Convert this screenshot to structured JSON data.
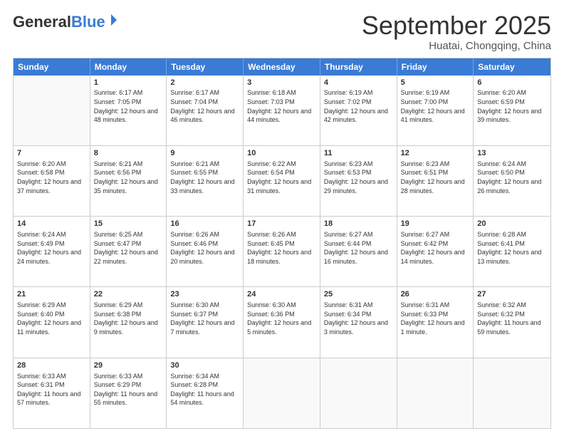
{
  "header": {
    "logo": {
      "general": "General",
      "blue": "Blue"
    },
    "title": "September 2025",
    "location": "Huatai, Chongqing, China"
  },
  "calendar": {
    "days_of_week": [
      "Sunday",
      "Monday",
      "Tuesday",
      "Wednesday",
      "Thursday",
      "Friday",
      "Saturday"
    ],
    "weeks": [
      [
        {
          "day": "",
          "sunrise": "",
          "sunset": "",
          "daylight": ""
        },
        {
          "day": "1",
          "sunrise": "Sunrise: 6:17 AM",
          "sunset": "Sunset: 7:05 PM",
          "daylight": "Daylight: 12 hours and 48 minutes."
        },
        {
          "day": "2",
          "sunrise": "Sunrise: 6:17 AM",
          "sunset": "Sunset: 7:04 PM",
          "daylight": "Daylight: 12 hours and 46 minutes."
        },
        {
          "day": "3",
          "sunrise": "Sunrise: 6:18 AM",
          "sunset": "Sunset: 7:03 PM",
          "daylight": "Daylight: 12 hours and 44 minutes."
        },
        {
          "day": "4",
          "sunrise": "Sunrise: 6:19 AM",
          "sunset": "Sunset: 7:02 PM",
          "daylight": "Daylight: 12 hours and 42 minutes."
        },
        {
          "day": "5",
          "sunrise": "Sunrise: 6:19 AM",
          "sunset": "Sunset: 7:00 PM",
          "daylight": "Daylight: 12 hours and 41 minutes."
        },
        {
          "day": "6",
          "sunrise": "Sunrise: 6:20 AM",
          "sunset": "Sunset: 6:59 PM",
          "daylight": "Daylight: 12 hours and 39 minutes."
        }
      ],
      [
        {
          "day": "7",
          "sunrise": "Sunrise: 6:20 AM",
          "sunset": "Sunset: 6:58 PM",
          "daylight": "Daylight: 12 hours and 37 minutes."
        },
        {
          "day": "8",
          "sunrise": "Sunrise: 6:21 AM",
          "sunset": "Sunset: 6:56 PM",
          "daylight": "Daylight: 12 hours and 35 minutes."
        },
        {
          "day": "9",
          "sunrise": "Sunrise: 6:21 AM",
          "sunset": "Sunset: 6:55 PM",
          "daylight": "Daylight: 12 hours and 33 minutes."
        },
        {
          "day": "10",
          "sunrise": "Sunrise: 6:22 AM",
          "sunset": "Sunset: 6:54 PM",
          "daylight": "Daylight: 12 hours and 31 minutes."
        },
        {
          "day": "11",
          "sunrise": "Sunrise: 6:23 AM",
          "sunset": "Sunset: 6:53 PM",
          "daylight": "Daylight: 12 hours and 29 minutes."
        },
        {
          "day": "12",
          "sunrise": "Sunrise: 6:23 AM",
          "sunset": "Sunset: 6:51 PM",
          "daylight": "Daylight: 12 hours and 28 minutes."
        },
        {
          "day": "13",
          "sunrise": "Sunrise: 6:24 AM",
          "sunset": "Sunset: 6:50 PM",
          "daylight": "Daylight: 12 hours and 26 minutes."
        }
      ],
      [
        {
          "day": "14",
          "sunrise": "Sunrise: 6:24 AM",
          "sunset": "Sunset: 6:49 PM",
          "daylight": "Daylight: 12 hours and 24 minutes."
        },
        {
          "day": "15",
          "sunrise": "Sunrise: 6:25 AM",
          "sunset": "Sunset: 6:47 PM",
          "daylight": "Daylight: 12 hours and 22 minutes."
        },
        {
          "day": "16",
          "sunrise": "Sunrise: 6:26 AM",
          "sunset": "Sunset: 6:46 PM",
          "daylight": "Daylight: 12 hours and 20 minutes."
        },
        {
          "day": "17",
          "sunrise": "Sunrise: 6:26 AM",
          "sunset": "Sunset: 6:45 PM",
          "daylight": "Daylight: 12 hours and 18 minutes."
        },
        {
          "day": "18",
          "sunrise": "Sunrise: 6:27 AM",
          "sunset": "Sunset: 6:44 PM",
          "daylight": "Daylight: 12 hours and 16 minutes."
        },
        {
          "day": "19",
          "sunrise": "Sunrise: 6:27 AM",
          "sunset": "Sunset: 6:42 PM",
          "daylight": "Daylight: 12 hours and 14 minutes."
        },
        {
          "day": "20",
          "sunrise": "Sunrise: 6:28 AM",
          "sunset": "Sunset: 6:41 PM",
          "daylight": "Daylight: 12 hours and 13 minutes."
        }
      ],
      [
        {
          "day": "21",
          "sunrise": "Sunrise: 6:29 AM",
          "sunset": "Sunset: 6:40 PM",
          "daylight": "Daylight: 12 hours and 11 minutes."
        },
        {
          "day": "22",
          "sunrise": "Sunrise: 6:29 AM",
          "sunset": "Sunset: 6:38 PM",
          "daylight": "Daylight: 12 hours and 9 minutes."
        },
        {
          "day": "23",
          "sunrise": "Sunrise: 6:30 AM",
          "sunset": "Sunset: 6:37 PM",
          "daylight": "Daylight: 12 hours and 7 minutes."
        },
        {
          "day": "24",
          "sunrise": "Sunrise: 6:30 AM",
          "sunset": "Sunset: 6:36 PM",
          "daylight": "Daylight: 12 hours and 5 minutes."
        },
        {
          "day": "25",
          "sunrise": "Sunrise: 6:31 AM",
          "sunset": "Sunset: 6:34 PM",
          "daylight": "Daylight: 12 hours and 3 minutes."
        },
        {
          "day": "26",
          "sunrise": "Sunrise: 6:31 AM",
          "sunset": "Sunset: 6:33 PM",
          "daylight": "Daylight: 12 hours and 1 minute."
        },
        {
          "day": "27",
          "sunrise": "Sunrise: 6:32 AM",
          "sunset": "Sunset: 6:32 PM",
          "daylight": "Daylight: 11 hours and 59 minutes."
        }
      ],
      [
        {
          "day": "28",
          "sunrise": "Sunrise: 6:33 AM",
          "sunset": "Sunset: 6:31 PM",
          "daylight": "Daylight: 11 hours and 57 minutes."
        },
        {
          "day": "29",
          "sunrise": "Sunrise: 6:33 AM",
          "sunset": "Sunset: 6:29 PM",
          "daylight": "Daylight: 11 hours and 55 minutes."
        },
        {
          "day": "30",
          "sunrise": "Sunrise: 6:34 AM",
          "sunset": "Sunset: 6:28 PM",
          "daylight": "Daylight: 11 hours and 54 minutes."
        },
        {
          "day": "",
          "sunrise": "",
          "sunset": "",
          "daylight": ""
        },
        {
          "day": "",
          "sunrise": "",
          "sunset": "",
          "daylight": ""
        },
        {
          "day": "",
          "sunrise": "",
          "sunset": "",
          "daylight": ""
        },
        {
          "day": "",
          "sunrise": "",
          "sunset": "",
          "daylight": ""
        }
      ]
    ]
  }
}
